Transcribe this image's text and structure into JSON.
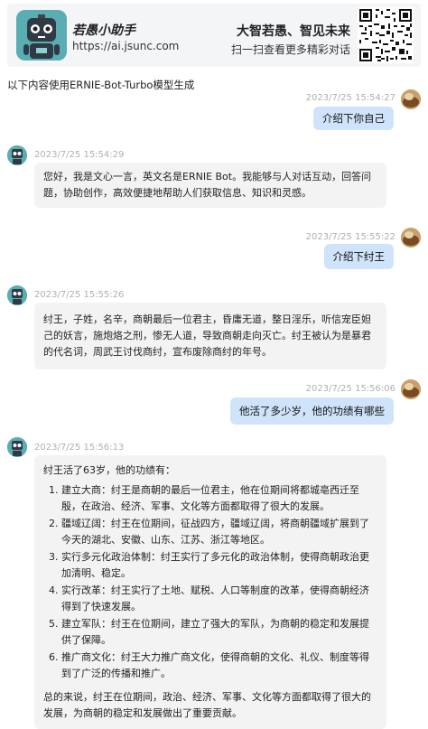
{
  "header": {
    "brand_name": "若愚小助手",
    "brand_url": "https://ai.jsunc.com",
    "slogan": "大智若愚、智见未来",
    "slogan_sub": "扫一扫查看更多精彩对话"
  },
  "note": "以下内容使用ERNIE-Bot-Turbo模型生成",
  "messages": {
    "u1": {
      "time": "2023/7/25 15:54:27",
      "text": "介绍下你自己"
    },
    "b1": {
      "time": "2023/7/25 15:54:29",
      "text": "您好，我是文心一言，英文名是ERNIE Bot。我能够与人对话互动，回答问题，协助创作，高效便捷地帮助人们获取信息、知识和灵感。"
    },
    "u2": {
      "time": "2023/7/25 15:55:22",
      "text": "介绍下纣王"
    },
    "b2": {
      "time": "2023/7/25 15:55:26",
      "text": "纣王，子姓，名辛，商朝最后一位君主，昏庸无道，整日淫乐，听信宠臣妲己的妖言，施炮烙之刑，惨无人道，导致商朝走向灭亡。纣王被认为是暴君的代名词，周武王讨伐商纣，宣布废除商纣的年号。"
    },
    "u3": {
      "time": "2023/7/25 15:56:06",
      "text": "他活了多少岁，他的功绩有哪些"
    },
    "b3": {
      "time": "2023/7/25 15:56:13",
      "intro": "纣王活了63岁，他的功绩有：",
      "items": [
        "建立大商：纣王是商朝的最后一位君主，他在位期间将都城亳西迁至殷，在政治、经济、军事、文化等方面都取得了很大的发展。",
        "疆域辽阔：纣王在位期间，征战四方，疆域辽阔，将商朝疆域扩展到了今天的湖北、安徽、山东、江苏、浙江等地区。",
        "实行多元化政治体制：纣王实行了多元化的政治体制，使得商朝政治更加清明、稳定。",
        "实行改革：纣王实行了土地、赋税、人口等制度的改革，使得商朝经济得到了快速发展。",
        "建立军队：纣王在位期间，建立了强大的军队，为商朝的稳定和发展提供了保障。",
        "推广商文化：纣王大力推广商文化，使得商朝的文化、礼仪、制度等得到了广泛的传播和推广。"
      ],
      "summary": "总的来说，纣王在位期间，政治、经济、军事、文化等方面都取得了很大的发展，为商朝的稳定和发展做出了重要贡献。"
    }
  },
  "colors": {
    "user_bubble": "#cfe3fa",
    "bot_bubble": "#f3f3f4",
    "header_bg": "#f4f5f7",
    "robot_teal": "#5aaeb3"
  },
  "icons": {
    "logo": "robot-logo-icon",
    "bot_avatar": "robot-avatar-icon",
    "user_avatar": "user-photo-avatar",
    "qr": "qr-code-icon",
    "more": "more-dots-icon"
  }
}
